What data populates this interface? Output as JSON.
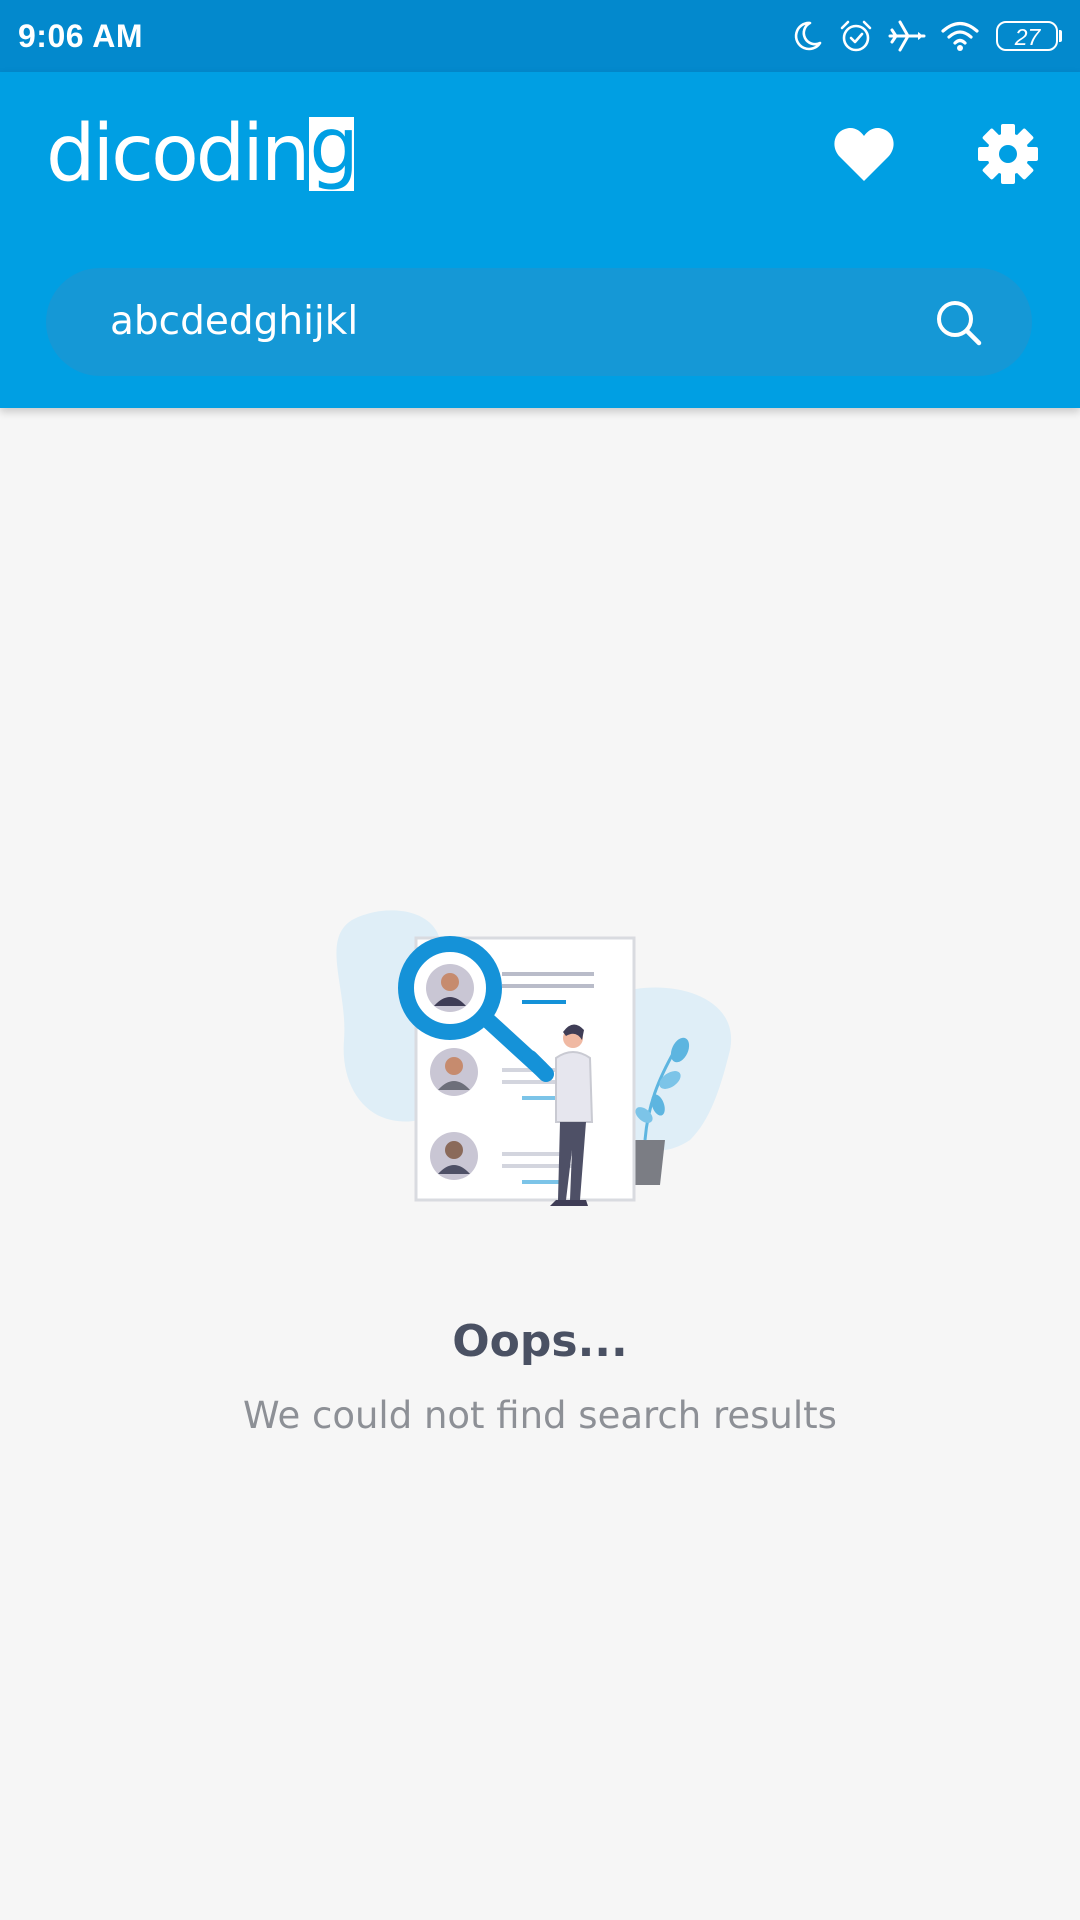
{
  "status_bar": {
    "time": "9:06 AM",
    "battery_level": "27",
    "icons": [
      "moon-icon",
      "alarm-icon",
      "airplane-icon",
      "wifi-icon",
      "battery-icon"
    ]
  },
  "app_bar": {
    "logo_text_main": "dicodin",
    "logo_text_boxed": "g",
    "actions": [
      "heart-icon",
      "gear-icon"
    ]
  },
  "search": {
    "value": "abcdedghijkl",
    "placeholder": "",
    "icon": "search-icon"
  },
  "empty_state": {
    "title": "Oops...",
    "message": "We could not find search results",
    "illustration": "profile-search-illustration"
  },
  "colors": {
    "status_bar": "#0389cd",
    "app_bar": "#009fe3",
    "search_pill": "#1598d6",
    "background": "#f6f6f6",
    "title": "#4a5163",
    "message": "#8d9096"
  }
}
